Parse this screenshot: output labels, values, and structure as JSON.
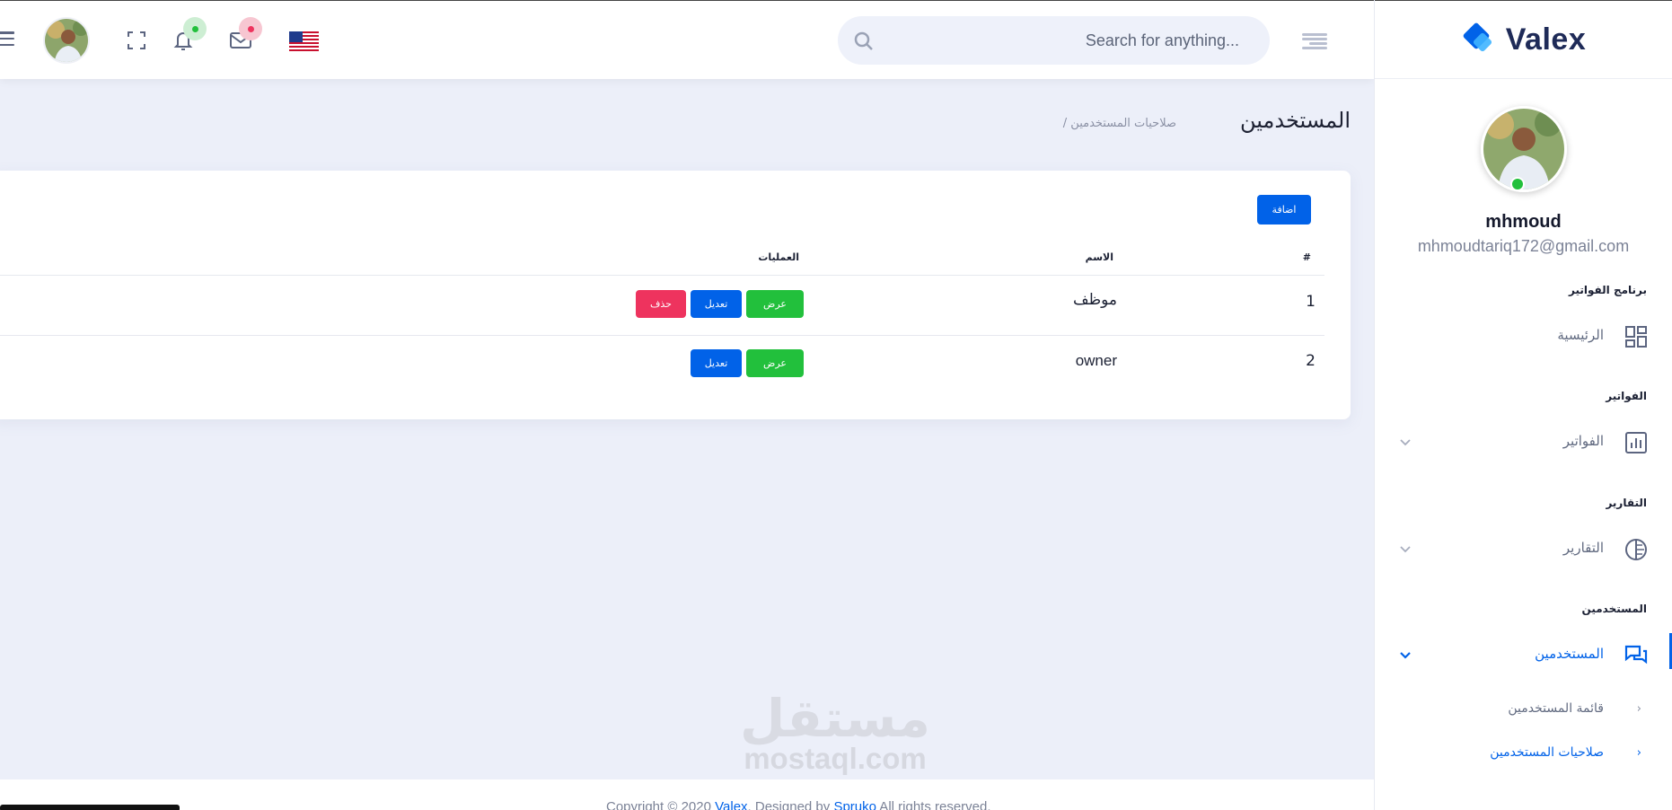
{
  "header": {
    "search": {
      "placeholder": "Search for anything..."
    },
    "flag_icon": "us-flag-icon",
    "notification_badge_color": "#22c03c",
    "message_badge_color": "#ee335e"
  },
  "sidebar": {
    "brand": "Valex",
    "user": {
      "name": "mhmoud",
      "email": "mhmoudtariq172@gmail.com"
    },
    "categories": {
      "billing_app": "برنامج الفواتير",
      "invoices": "الفواتير",
      "reports": "التقارير",
      "users": "المستخدمين"
    },
    "nav": {
      "home": "الرئيسية",
      "invoices": "الفواتير",
      "reports": "التقارير",
      "users": "المستخدمين"
    },
    "sub": {
      "users_list": "قائمة المستخدمين",
      "users_permissions": "صلاحيات المستخدمين"
    }
  },
  "page": {
    "title": "المستخدمين",
    "breadcrumb": "/ صلاحيات المستخدمين"
  },
  "card": {
    "add_button": "اضافة",
    "columns": {
      "index": "#",
      "name": "الاسم",
      "actions": "العمليات"
    },
    "rows": [
      {
        "index": "1",
        "name": "موظف",
        "view": "عرض",
        "edit": "تعديل",
        "delete": "حذف"
      },
      {
        "index": "2",
        "name": "owner",
        "view": "عرض",
        "edit": "تعديل"
      }
    ]
  },
  "footer": {
    "prefix": "Copyright © 2020 ",
    "brand": "Valex",
    "middle": ". Designed by ",
    "designer": "Spruko",
    "suffix": " All rights reserved."
  },
  "watermark": {
    "arabic": "مستقل",
    "latin": "mostaql.com"
  },
  "colors": {
    "primary": "#0162e8",
    "success": "#22c03c",
    "danger": "#ee335e",
    "background": "#eceff9"
  }
}
